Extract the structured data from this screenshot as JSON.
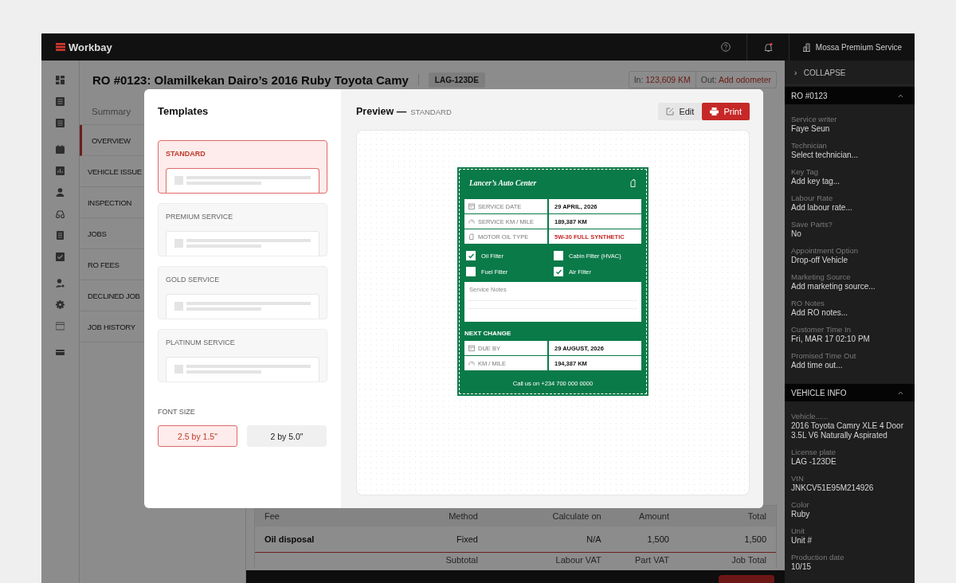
{
  "app": {
    "name": "Workbay",
    "account": "Mossa Premium Service",
    "notifications": true
  },
  "header": {
    "title": "RO #0123: Olamilkekan Dairo’s 2016 Ruby Toyota Camy",
    "plate": "LAG-123DE",
    "in_label": "In:",
    "in_value": "123,609 KM",
    "out_label": "Out:",
    "out_value": "Add odometer"
  },
  "nav": {
    "tab": "Summary",
    "items": [
      {
        "label": "OVERVIEW",
        "selected": true
      },
      {
        "label": "VEHICLE ISSUE",
        "selected": false
      },
      {
        "label": "INSPECTION",
        "selected": false
      },
      {
        "label": "JOBS",
        "selected": false
      },
      {
        "label": "RO FEES",
        "selected": false
      },
      {
        "label": "DECLINED JOB",
        "selected": false
      },
      {
        "label": "JOB HISTORY",
        "selected": false
      }
    ]
  },
  "fees_table": {
    "columns": [
      "Fee",
      "Method",
      "Calculate on",
      "Amount",
      "Total"
    ],
    "rows": [
      [
        "Oil disposal",
        "Fixed",
        "N/A",
        "1,500",
        "1,500"
      ]
    ],
    "footer": [
      "Subtotal",
      "Labour VAT",
      "Part VAT",
      "Job Total"
    ]
  },
  "side_panel": {
    "collapse_icon": "›",
    "collapse": "COLLAPSE",
    "sections": [
      {
        "title": "RO #0123",
        "expanded": true,
        "fields": [
          {
            "label": "Service writer",
            "value": "Faye Seun"
          },
          {
            "label": "Technician",
            "value": "Select technician..."
          },
          {
            "label": "Key Tag",
            "value": "Add key tag..."
          },
          {
            "label": "Labour Rate",
            "value": "Add labour rate..."
          },
          {
            "label": "Save Parts?",
            "value": "No"
          },
          {
            "label": "Appointment Option",
            "value": "Drop-off Vehicle"
          },
          {
            "label": "Marketing Source",
            "value": "Add marketing source..."
          },
          {
            "label": "RO Notes",
            "value": "Add RO notes..."
          },
          {
            "label": "Customer Time In",
            "value": "Fri, MAR 17 02:10 PM"
          },
          {
            "label": "Promised Time Out",
            "value": "Add time out..."
          }
        ]
      },
      {
        "title": "VEHICLE INFO",
        "expanded": true,
        "fields": [
          {
            "label": "Vehicle......",
            "value": "2016 Toyota Camry XLE 4 Door 3.5L V6 Naturally Aspirated"
          },
          {
            "label": "License plate",
            "value": "LAG -123DE"
          },
          {
            "label": "VIN",
            "value": "JNKCV51E95M214926"
          },
          {
            "label": "Color",
            "value": "Ruby"
          },
          {
            "label": "Unit",
            "value": "Unit #"
          },
          {
            "label": "Production date",
            "value": "10/15"
          }
        ]
      }
    ]
  },
  "modal": {
    "templates_title": "Templates",
    "templates": [
      {
        "name": "STANDARD",
        "selected": true
      },
      {
        "name": "PREMIUM SERVICE",
        "selected": false
      },
      {
        "name": "GOLD SERVICE",
        "selected": false
      },
      {
        "name": "PLATINUM SERVICE",
        "selected": false
      }
    ],
    "font_size_label": "FONT SIZE",
    "font_sizes": [
      {
        "label": "2.5 by 1.5\"",
        "selected": true
      },
      {
        "label": "2 by 5.0\"",
        "selected": false
      }
    ],
    "preview_title": "Preview —",
    "preview_template": "STANDARD",
    "edit": "Edit",
    "print": "Print",
    "label": {
      "shop": "Lancer’s Auto Center",
      "rows": [
        {
          "kind": "date",
          "label": "SERVICE DATE",
          "value": "29 APRIL, 2026",
          "alert": false
        },
        {
          "kind": "distance",
          "label": "SERVICE KM / MILE",
          "value": "189,387 KM",
          "alert": false
        },
        {
          "kind": "oil",
          "label": "MOTOR OIL TYPE",
          "value": "5W-30 FULL SYNTHETIC",
          "alert": true
        }
      ],
      "checks": [
        {
          "label": "Oil Filter",
          "checked": true
        },
        {
          "label": "Cabin Filter (HVAC)",
          "checked": false
        },
        {
          "label": "Fuel Filter",
          "checked": false
        },
        {
          "label": "Air Filter",
          "checked": true
        }
      ],
      "notes_label": "Service Notes",
      "next_title": "NEXT CHANGE",
      "next_rows": [
        {
          "kind": "date",
          "label": "DUE BY",
          "value": "29 AUGUST, 2026",
          "alert": false
        },
        {
          "kind": "distance",
          "label": "KM / MILE",
          "value": "194,387 KM",
          "alert": false
        }
      ],
      "footer": "Call us on +234 700 000 0000"
    }
  }
}
